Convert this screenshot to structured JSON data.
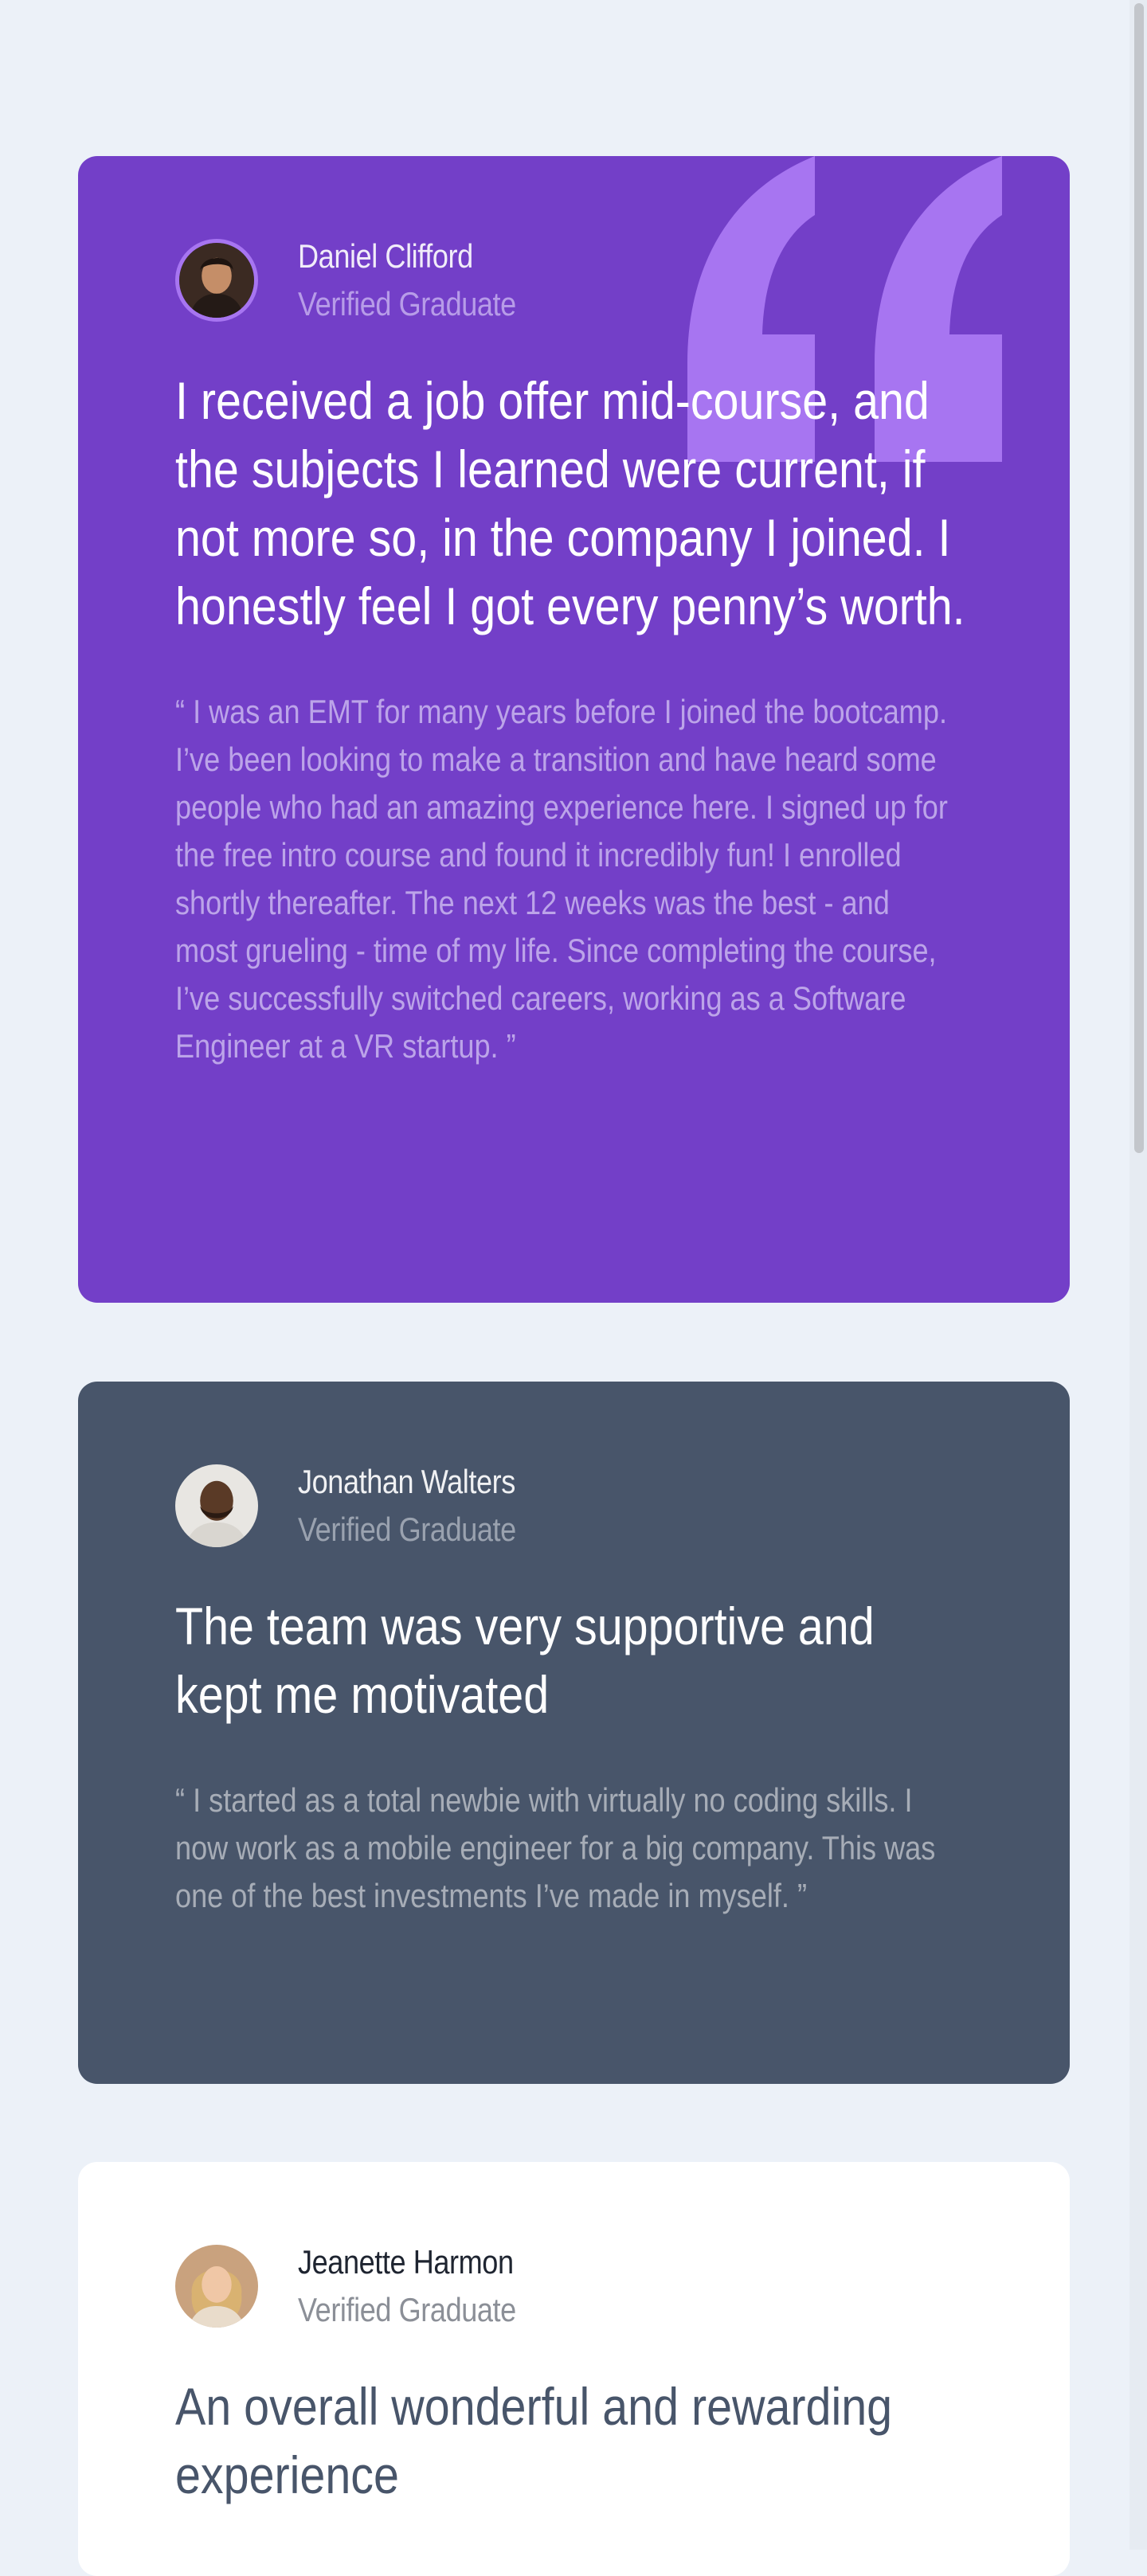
{
  "colors": {
    "page_background": "#ECF1F8",
    "purple_card": "#733FC8",
    "quote_mark": "#A775F1",
    "slate_card": "#48556A",
    "white_card": "#FFFFFF"
  },
  "testimonials": [
    {
      "name": "Daniel Clifford",
      "status": "Verified Graduate",
      "headline": "I received a job offer mid-course, and the subjects I learned were current, if not more so, in the company I joined. I honestly feel I got every penny’s worth.",
      "body": "“ I was an EMT for many years before I joined the bootcamp. I’ve been looking to make a transition and have heard some people who had an amazing experience here. I signed up for the free intro course and found it incredibly fun! I enrolled shortly thereafter. The next 12 weeks was the best - and most grueling - time of my life. Since completing the course, I’ve successfully switched careers, working as a Software Engineer at a VR startup. ”",
      "icon": "quotation-mark-icon"
    },
    {
      "name": "Jonathan Walters",
      "status": "Verified Graduate",
      "headline": "The team was very supportive and kept me motivated",
      "body": "“ I started as a total newbie with virtually no coding skills. I now work as a mobile engineer for a big company. This was one of the best investments I’ve made in myself. ”"
    },
    {
      "name": "Jeanette Harmon",
      "status": "Verified Graduate",
      "headline": "An overall wonderful and rewarding experience"
    }
  ]
}
